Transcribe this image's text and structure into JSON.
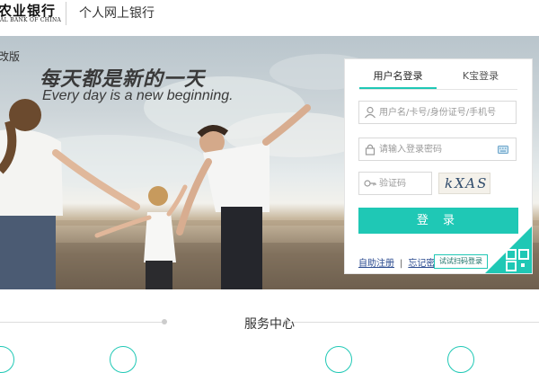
{
  "header": {
    "logo_cn": "农业银行",
    "logo_en": "AL BANK OF CHINA",
    "title": "个人网上银行"
  },
  "banner": {
    "old_version_label": "改版",
    "slogan_cn": "每天都是新的一天",
    "slogan_en": "Every day is a new beginning."
  },
  "login": {
    "tabs": [
      {
        "label": "用户名登录",
        "active": true
      },
      {
        "label": "K宝登录",
        "active": false
      }
    ],
    "username_placeholder": "用户名/卡号/身份证号/手机号",
    "password_placeholder": "请输入登录密码",
    "captcha_placeholder": "验证码",
    "captcha_text": "kXAS",
    "login_button": "登 录",
    "register_link": "自助注册",
    "forgot_link": "忘记密",
    "qr_tip": "试试扫码登录"
  },
  "service": {
    "title": "服务中心"
  },
  "colors": {
    "accent": "#1fc8b5",
    "link": "#2a4a8f"
  },
  "icons": [
    "user-icon",
    "lock-icon",
    "keyboard-icon",
    "key-icon",
    "qr-code-icon"
  ]
}
